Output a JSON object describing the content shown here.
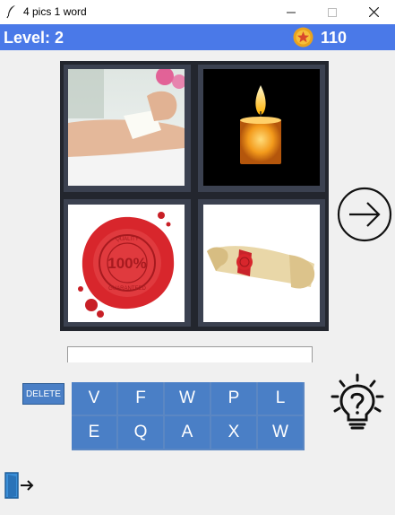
{
  "window": {
    "title": "4 pics 1 word"
  },
  "header": {
    "level_label": "Level: 2",
    "coins": "110"
  },
  "pictures": [
    {
      "name": "waxing"
    },
    {
      "name": "candle"
    },
    {
      "name": "wax-seal"
    },
    {
      "name": "sealed-scroll"
    }
  ],
  "answer": {
    "value": ""
  },
  "buttons": {
    "delete_label": "DELETE"
  },
  "letters": [
    "V",
    "F",
    "W",
    "P",
    "L",
    "E",
    "Q",
    "A",
    "X",
    "W"
  ],
  "icons": {
    "next": "arrow-right-circle-icon",
    "hint": "lightbulb-question-icon",
    "exit": "exit-door-icon",
    "coin": "coin-star-icon"
  },
  "colors": {
    "header": "#4a79e8",
    "letter_tile": "#4a7fc6"
  }
}
